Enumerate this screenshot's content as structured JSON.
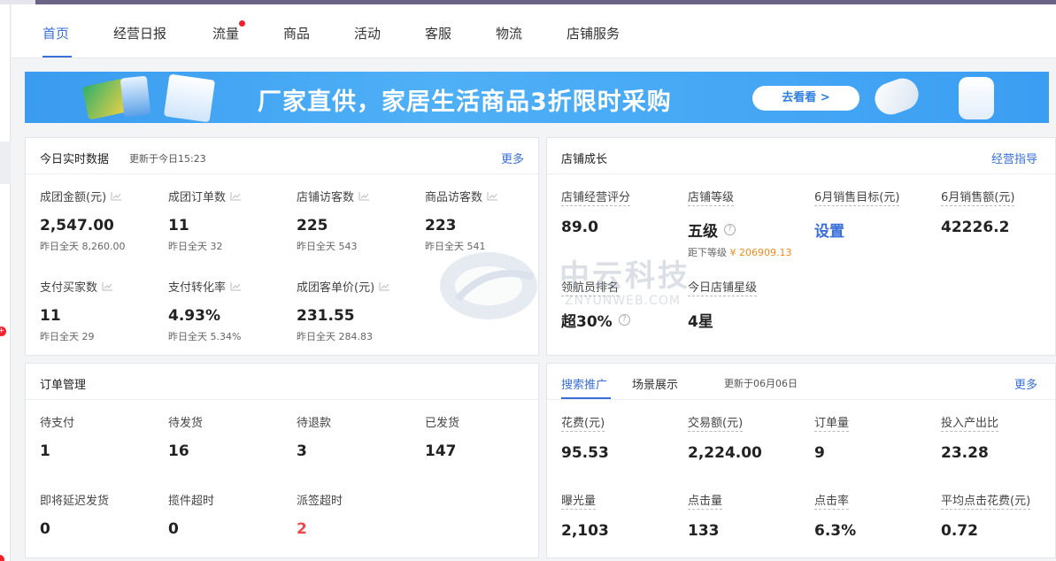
{
  "nav": {
    "tabs": [
      {
        "label": "首页",
        "active": true
      },
      {
        "label": "经营日报"
      },
      {
        "label": "流量",
        "badge_dot": true
      },
      {
        "label": "商品"
      },
      {
        "label": "活动"
      },
      {
        "label": "客服"
      },
      {
        "label": "物流"
      },
      {
        "label": "店铺服务"
      }
    ]
  },
  "banner": {
    "headline": "厂家直供，家居生活商品3折限时采购",
    "cta": "去看看 >"
  },
  "realtime": {
    "title": "今日实时数据",
    "updated": "更新于今日15:23",
    "more": "更多",
    "metrics": [
      {
        "label": "成团金额(元)",
        "value": "2,547.00",
        "yesterday": "昨日全天 8,260.00"
      },
      {
        "label": "成团订单数",
        "value": "11",
        "yesterday": "昨日全天 32"
      },
      {
        "label": "店铺访客数",
        "value": "225",
        "yesterday": "昨日全天 543"
      },
      {
        "label": "商品访客数",
        "value": "223",
        "yesterday": "昨日全天 541"
      },
      {
        "label": "支付买家数",
        "value": "11",
        "yesterday": "昨日全天 29"
      },
      {
        "label": "支付转化率",
        "value": "4.93%",
        "yesterday": "昨日全天 5.34%"
      },
      {
        "label": "成团客单价(元)",
        "value": "231.55",
        "yesterday": "昨日全天 284.83"
      }
    ]
  },
  "growth": {
    "title": "店铺成长",
    "more": "经营指导",
    "metrics": [
      {
        "label": "店铺经营评分",
        "value": "89.0"
      },
      {
        "label": "店铺等级",
        "value": "五级",
        "note_prefix": "距下等级",
        "note_value": "¥ 206909.13"
      },
      {
        "label": "6月销售目标(元)",
        "value": "设置"
      },
      {
        "label": "6月销售额(元)",
        "value": "42226.2"
      },
      {
        "label": "领航员排名",
        "value": "超30%"
      },
      {
        "label": "今日店铺星级",
        "value": "4星"
      }
    ]
  },
  "orders": {
    "title": "订单管理",
    "metrics": [
      {
        "label": "待支付",
        "value": "1"
      },
      {
        "label": "待发货",
        "value": "16"
      },
      {
        "label": "待退款",
        "value": "3"
      },
      {
        "label": "已发货",
        "value": "147"
      },
      {
        "label": "即将延迟发货",
        "value": "0"
      },
      {
        "label": "揽件超时",
        "value": "0"
      },
      {
        "label": "派签超时",
        "value": "2"
      }
    ]
  },
  "promo": {
    "tabs": [
      "搜索推广",
      "场景展示"
    ],
    "updated": "更新于06月06日",
    "more": "更多",
    "metrics": [
      {
        "label": "花费(元)",
        "value": "95.53"
      },
      {
        "label": "交易额(元)",
        "value": "2,224.00"
      },
      {
        "label": "订单量",
        "value": "9"
      },
      {
        "label": "投入产出比",
        "value": "23.28"
      },
      {
        "label": "曝光量",
        "value": "2,103"
      },
      {
        "label": "点击量",
        "value": "133"
      },
      {
        "label": "点击率",
        "value": "6.3%"
      },
      {
        "label": "平均点击花费(元)",
        "value": "0.72"
      }
    ]
  },
  "watermark": {
    "brand": "中云科技",
    "domain": "ZNYUNWEB.COM"
  },
  "colors": {
    "accent": "#3a6fd8",
    "alert": "#f04848",
    "orange": "#ef8a1e",
    "topbar": "#6b6486"
  }
}
